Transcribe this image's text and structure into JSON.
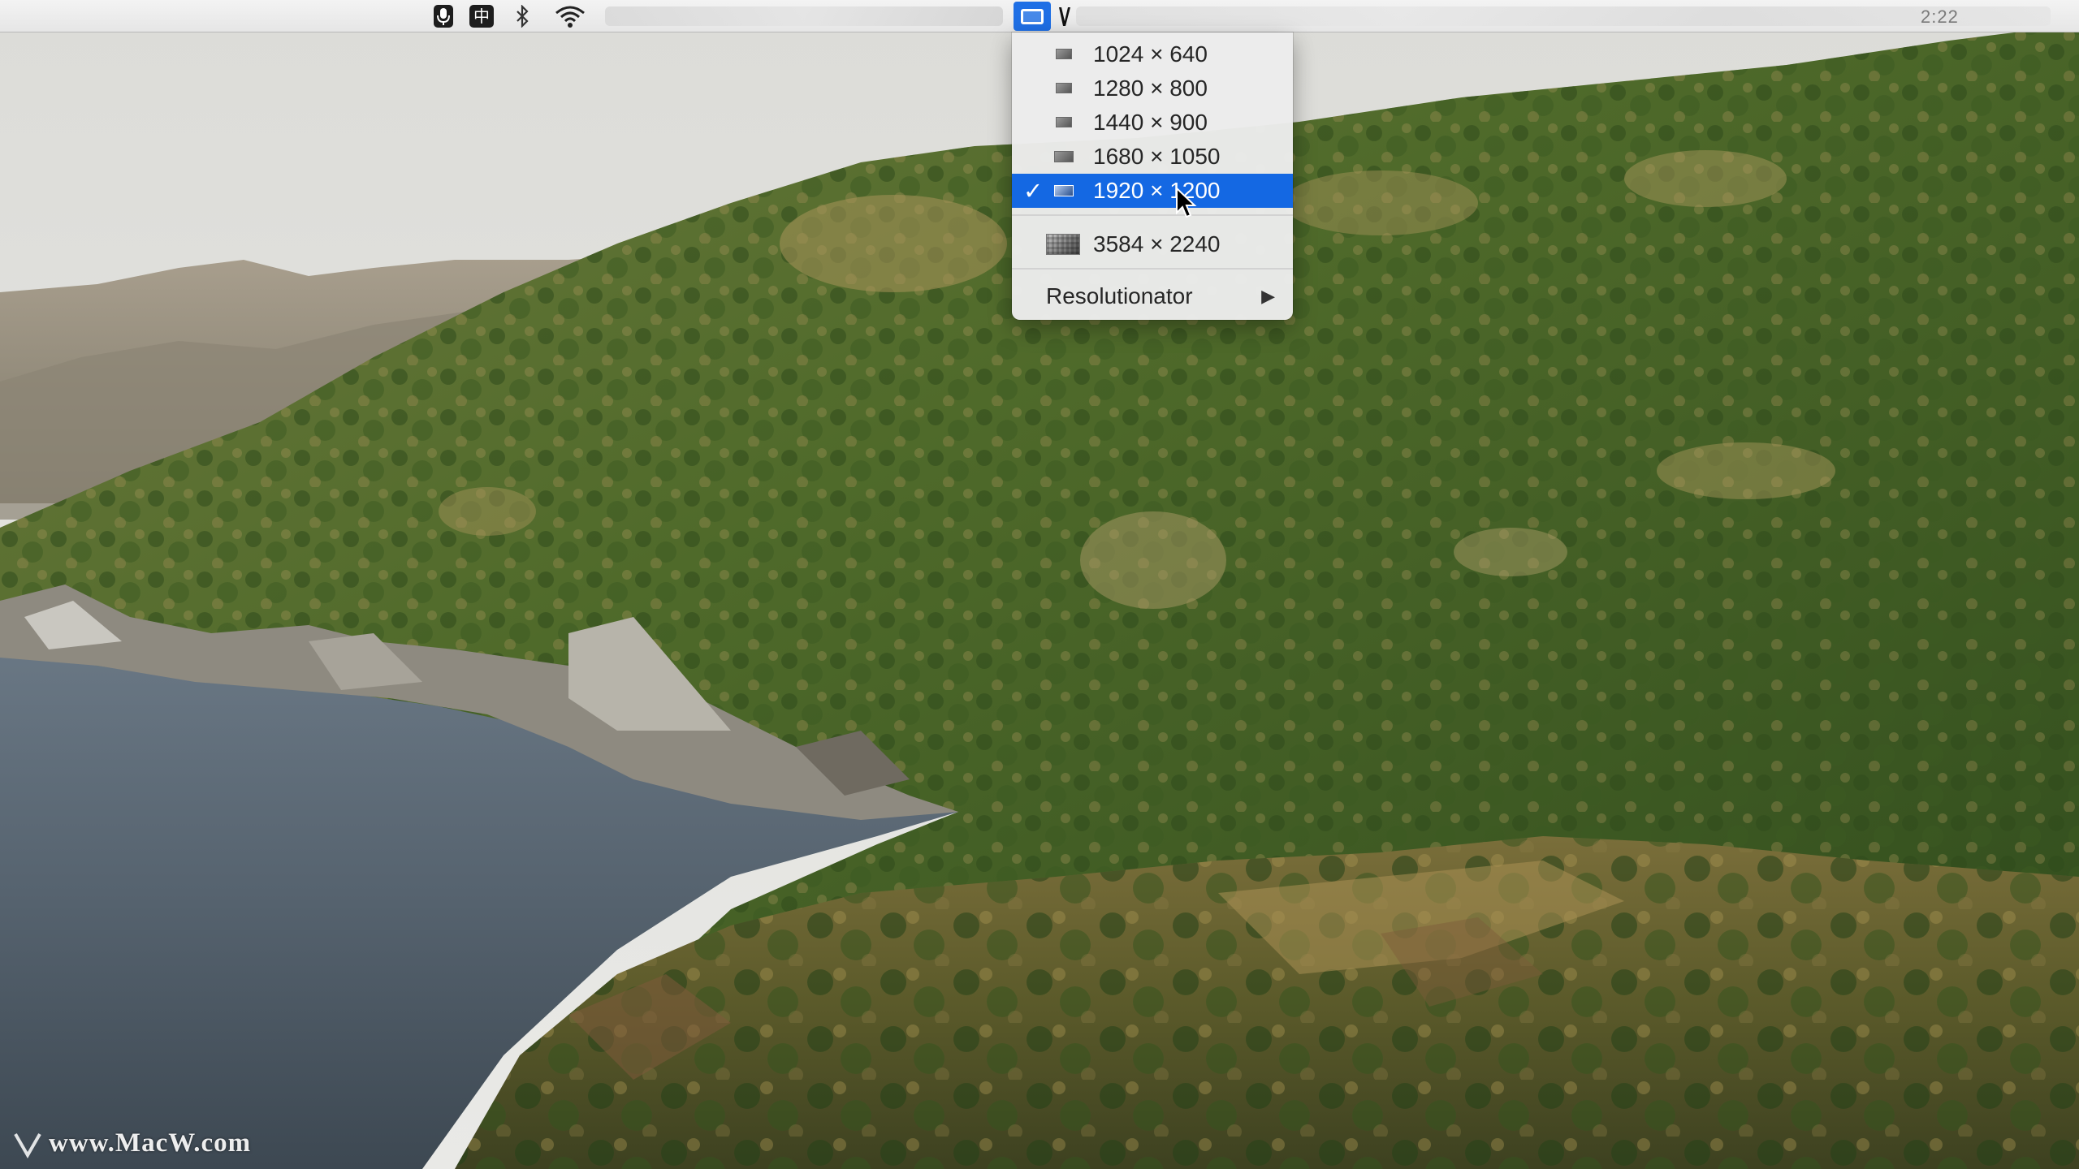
{
  "menubar": {
    "icons": [
      "microphone-icon",
      "chinese-input-icon",
      "bluetooth-icon",
      "wifi-icon",
      "display-resolution-icon"
    ],
    "input_method_label": "中",
    "clock": "2:22"
  },
  "dropdown": {
    "items": [
      {
        "label": "1024 × 640",
        "selected": false
      },
      {
        "label": "1280 × 800",
        "selected": false
      },
      {
        "label": "1440 × 900",
        "selected": false
      },
      {
        "label": "1680 × 1050",
        "selected": false
      },
      {
        "label": "1920 × 1200",
        "selected": true
      }
    ],
    "retina_item": {
      "label": "3584 × 2240"
    },
    "submenu": {
      "label": "Resolutionator",
      "arrow": "▶"
    },
    "check_mark": "✓"
  },
  "colors": {
    "selection": "#1468e3",
    "menubar": "#ececec"
  },
  "watermark": {
    "text": "www.MacW.com"
  }
}
